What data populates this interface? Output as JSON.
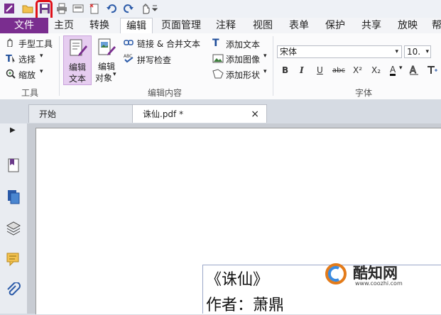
{
  "tabs": {
    "file": "文件",
    "home": "主页",
    "convert": "转换",
    "edit": "编辑",
    "page_manage": "页面管理",
    "comment": "注释",
    "view": "视图",
    "form": "表单",
    "protect": "保护",
    "share": "共享",
    "slideshow": "放映",
    "help_partial": "帮"
  },
  "ribbon": {
    "tools": {
      "hand": "手型工具",
      "select": "选择",
      "zoom": "缩放",
      "group": "工具"
    },
    "edit_content": {
      "edit_text_line1": "编辑",
      "edit_text_line2": "文本",
      "edit_object_line1": "编辑",
      "edit_object_line2": "对象",
      "link_merge": "链接 & 合并文本",
      "spell_check": "拼写检查",
      "add_text": "添加文本",
      "add_image": "添加图像",
      "add_shape": "添加形状",
      "group": "编辑内容"
    },
    "font": {
      "family": "宋体",
      "size": "10.",
      "bold": "B",
      "italic": "I",
      "underline": "U",
      "strike": "abc",
      "superscript": "X²",
      "subscript": "X₂",
      "color": "A",
      "group": "字体"
    }
  },
  "doc_tabs": {
    "start": "开始",
    "file": "诛仙.pdf *",
    "close": "×"
  },
  "document": {
    "line1": "《诛仙》",
    "line2": "作者：萧鼎"
  },
  "watermark": {
    "brand": "酷知网",
    "url": "www.coozhi.com"
  },
  "colors": {
    "accent": "#7a2d8f",
    "highlight": "#e0111a"
  }
}
